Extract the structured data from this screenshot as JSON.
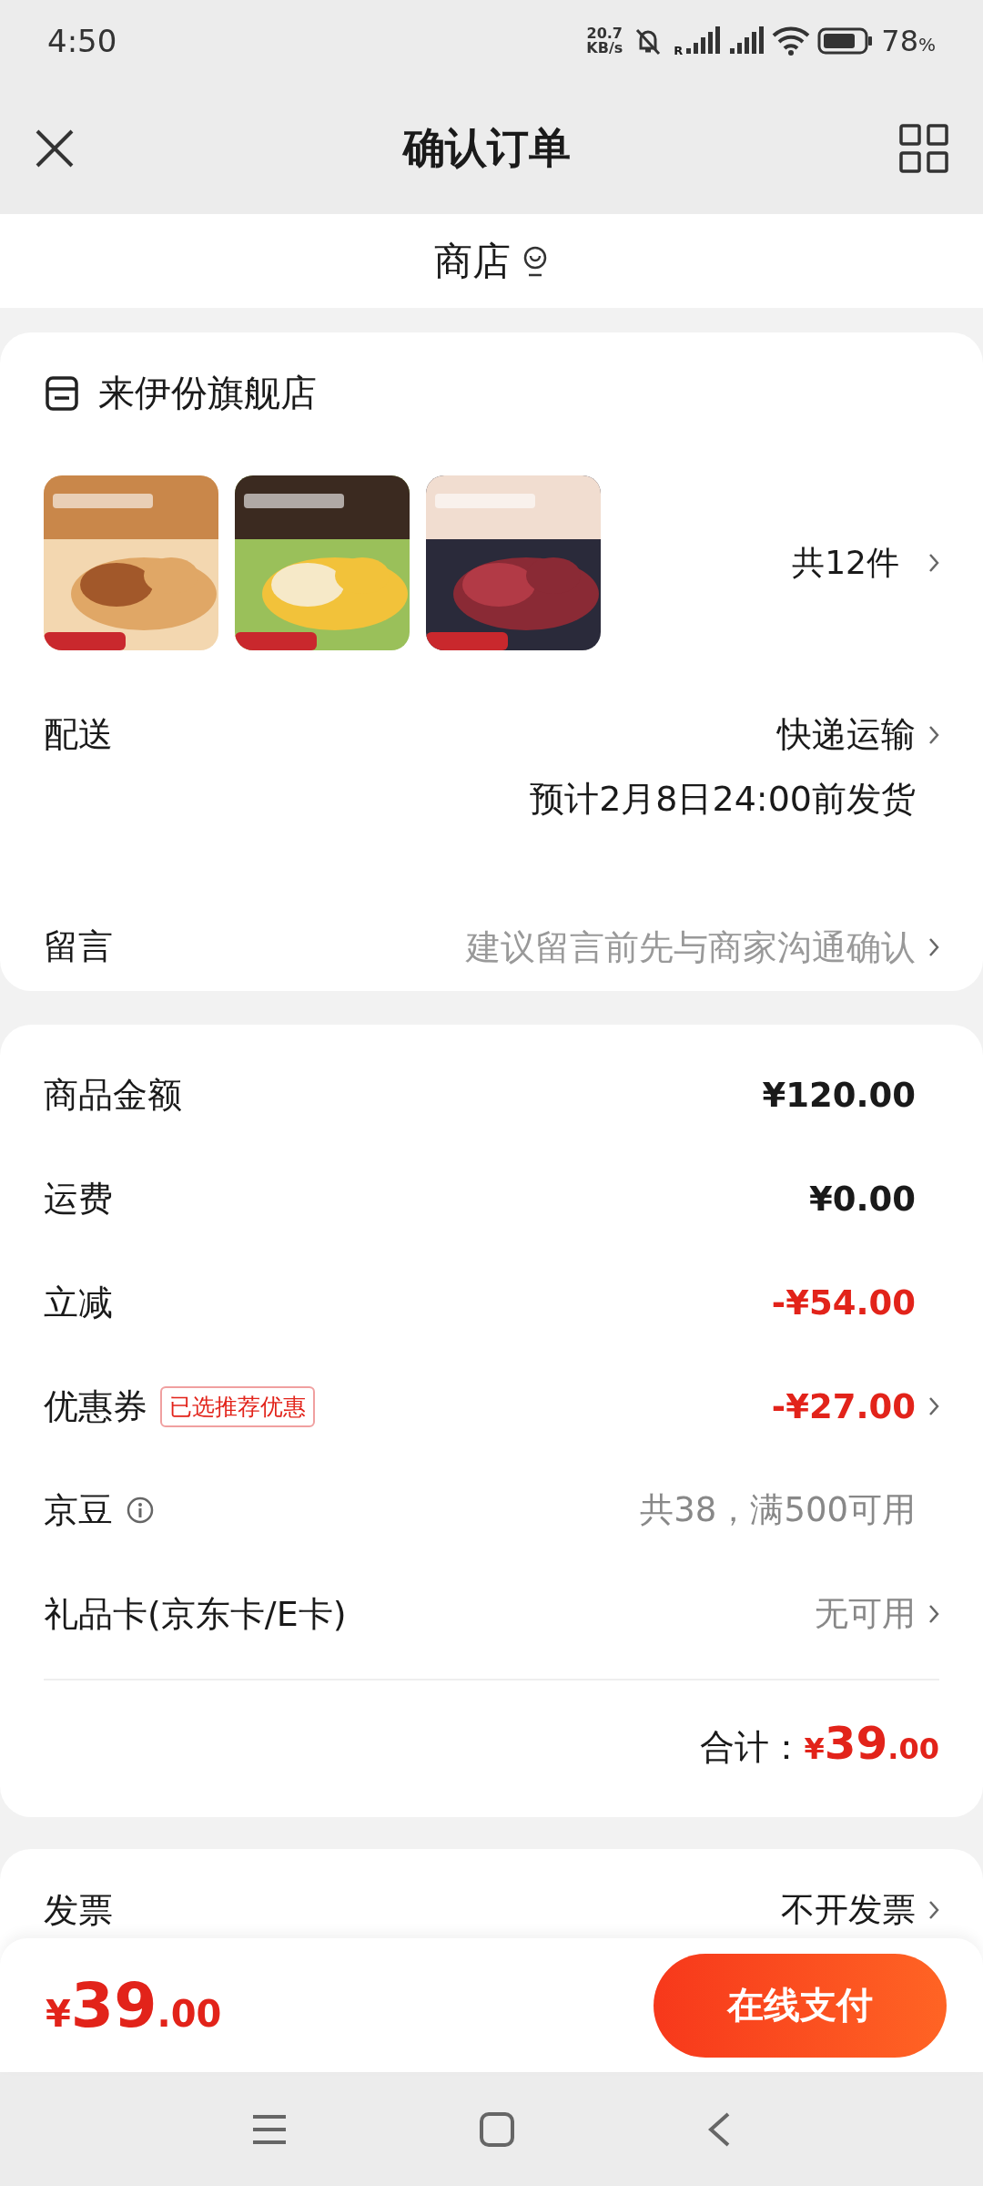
{
  "status_bar": {
    "time": "4:50",
    "net_speed_value": "20.7",
    "net_speed_unit": "KB/s",
    "signal_label": "R",
    "battery": "78",
    "battery_unit": "%"
  },
  "header": {
    "title": "确认订单"
  },
  "store_bar": {
    "label": "商店"
  },
  "order": {
    "shop_name": "来伊份旗舰店",
    "count": "共12件",
    "delivery": {
      "label": "配送",
      "method": "快递运输",
      "estimate": "预计2月8日24:00前发货"
    },
    "note": {
      "label": "留言",
      "placeholder": "建议留言前先与商家沟通确认"
    }
  },
  "fees": [
    {
      "label": "商品金额",
      "value": "¥120.00",
      "kind": "plain",
      "arrow": false
    },
    {
      "label": "运费",
      "value": "¥0.00",
      "kind": "plain",
      "arrow": false
    },
    {
      "label": "立减",
      "value": "-¥54.00",
      "kind": "discount",
      "arrow": false
    },
    {
      "label": "优惠券",
      "tag": "已选推荐优惠",
      "value": "-¥27.00",
      "kind": "discount",
      "arrow": true
    },
    {
      "label": "京豆",
      "info": true,
      "value": "共38，满500可用",
      "kind": "muted",
      "arrow": false
    },
    {
      "label": "礼品卡(京东卡/E卡)",
      "value": "无可用",
      "kind": "muted",
      "arrow": true
    }
  ],
  "total": {
    "label": "合计：",
    "amount": "¥39.00"
  },
  "invoice": {
    "label": "发票",
    "value": "不开发票"
  },
  "footer": {
    "amount": "¥39.00",
    "pay_button": "在线支付"
  }
}
